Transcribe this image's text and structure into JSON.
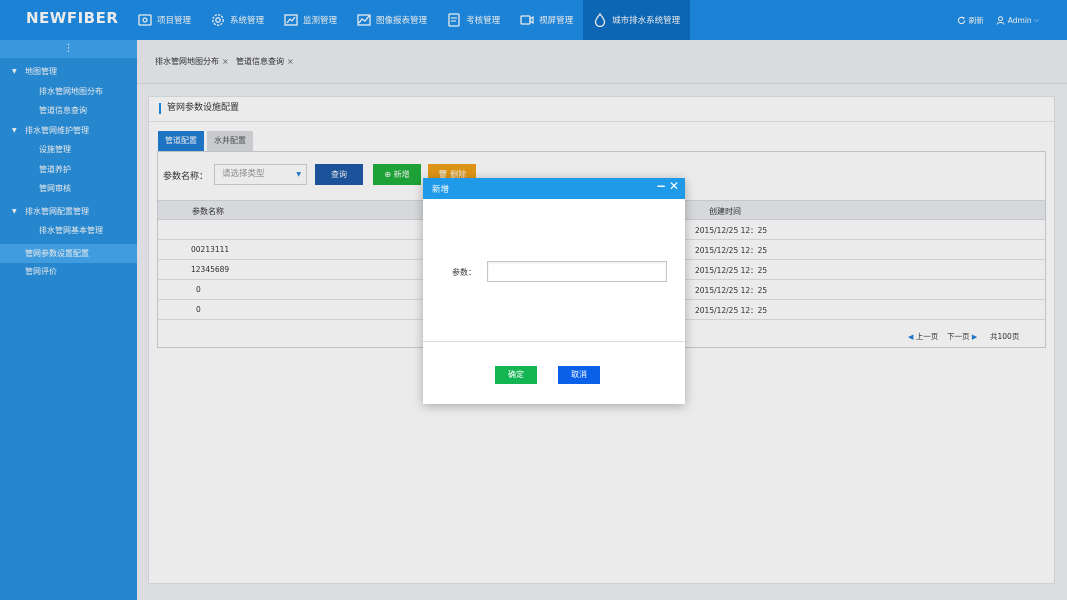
{
  "brand": {
    "logo_text": "NEWFIBER"
  },
  "nav": {
    "items": [
      {
        "label": "项目管理",
        "icon": "project-icon"
      },
      {
        "label": "系统管理",
        "icon": "gear-icon"
      },
      {
        "label": "监测管理",
        "icon": "monitor-chart-icon"
      },
      {
        "label": "图像报表管理",
        "icon": "line-chart-icon"
      },
      {
        "label": "考核管理",
        "icon": "document-icon"
      },
      {
        "label": "视屏管理",
        "icon": "video-camera-icon"
      },
      {
        "label": "城市排水系统管理",
        "icon": "water-drop-icon"
      }
    ],
    "active_index": 6
  },
  "top_right": {
    "refresh_label": "刷新",
    "user_label": "Admin"
  },
  "sidebar": {
    "toggle": "⋮",
    "items": [
      {
        "label": "地图管理",
        "type": "group"
      },
      {
        "label": "排水管网地图分布",
        "type": "sub"
      },
      {
        "label": "管道信息查询",
        "type": "sub"
      },
      {
        "label": "排水管网维护管理",
        "type": "group"
      },
      {
        "label": "设施管理",
        "type": "sub"
      },
      {
        "label": "管道养护",
        "type": "sub"
      },
      {
        "label": "管网审核",
        "type": "sub"
      },
      {
        "label": "排水管网配置管理",
        "type": "group"
      },
      {
        "label": "排水管网基本管理",
        "type": "sub"
      },
      {
        "label": "管网参数设置配置",
        "type": "plain",
        "active": true
      },
      {
        "label": "管网评价",
        "type": "plain"
      }
    ]
  },
  "tabs": [
    {
      "label": "排水管网地图分布",
      "close": "×"
    },
    {
      "label": "管道信息查询",
      "close": "×"
    }
  ],
  "page": {
    "title": "管网参数设施配置",
    "subtabs": [
      "管道配置",
      "水井配置"
    ],
    "filter_label": "参数名称：",
    "select_placeholder": "请选择类型",
    "buttons": {
      "query": "查询",
      "add": "新增",
      "delete": "删除"
    },
    "columns": [
      "参数名称",
      "创建时间"
    ],
    "rows": [
      {
        "name": "",
        "created": "2015/12/25  12：25"
      },
      {
        "name": "00213111",
        "created": "2015/12/25  12：25"
      },
      {
        "name": "12345689",
        "created": "2015/12/25  12：25"
      },
      {
        "name": "0",
        "created": "2015/12/25  12：25"
      },
      {
        "name": "0",
        "created": "2015/12/25  12：25"
      }
    ],
    "pager": {
      "prev": "上一页",
      "next": "下一页",
      "total": "共100页"
    }
  },
  "modal": {
    "title": "新增",
    "minimize": "−",
    "close": "✕",
    "field_label": "参数：",
    "field_value": "",
    "ok": "确定",
    "cancel": "取消"
  },
  "colors": {
    "topbar": "#1f8ee8",
    "sidebar": "#2a92e0",
    "modal_header": "#1f9ae8",
    "ok_button": "#13b553",
    "cancel_button": "#0a60e8"
  }
}
